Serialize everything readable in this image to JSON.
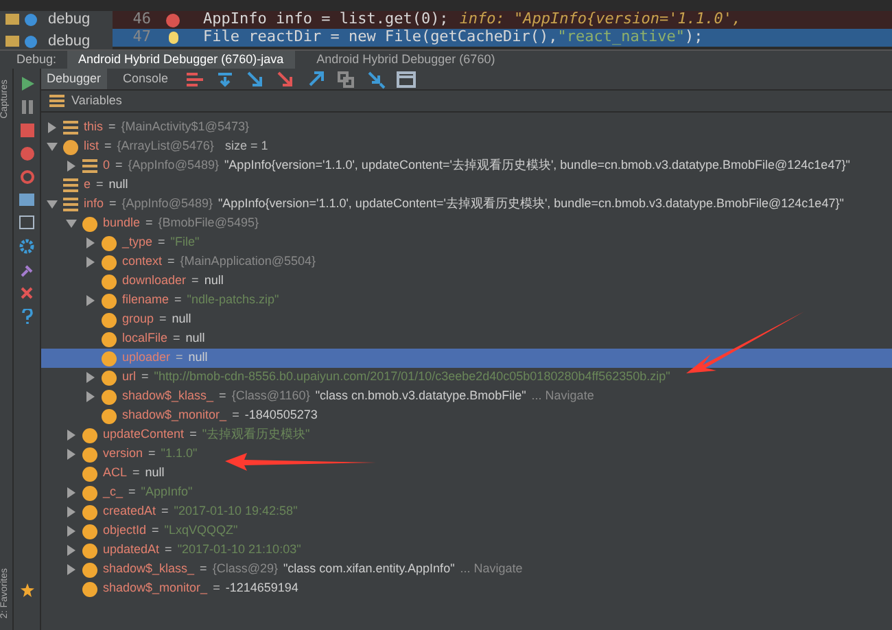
{
  "project_panel": {
    "items": [
      {
        "label": "debug"
      },
      {
        "label": "debug"
      }
    ]
  },
  "editor": {
    "lines": [
      {
        "number": "46",
        "kind": "breakpoint",
        "code": "AppInfo info = list.get(0);",
        "inline": "info: \"AppInfo{version='1.1.0',"
      },
      {
        "number": "47",
        "kind": "current",
        "code": "File reactDir = new File(getCacheDir(),",
        "string": "\"react_native\"",
        "tail": ");"
      }
    ]
  },
  "debug_bar": {
    "label": "Debug:",
    "tabs": [
      {
        "label": "Android Hybrid Debugger (6760)-java",
        "selected": true
      },
      {
        "label": "Android Hybrid Debugger (6760)",
        "selected": false
      }
    ]
  },
  "toolbar": {
    "tabs": [
      {
        "label": "Debugger",
        "selected": true
      },
      {
        "label": "Console",
        "selected": false
      }
    ]
  },
  "side_strip": {
    "labels": [
      "Captures",
      "2: Favorites"
    ]
  },
  "variables": {
    "title": "Variables",
    "tree": [
      {
        "kind": "local",
        "name": "this",
        "op": "=",
        "type": "{MainActivity$1@5473}",
        "expanded": false
      },
      {
        "kind": "parameter",
        "name": "list",
        "op": "=",
        "type": "{ArrayList@5476}",
        "extra": "size = 1",
        "expanded": true,
        "children": [
          {
            "kind": "local",
            "name": "0",
            "op": "=",
            "type": "{AppInfo@5489}",
            "value": "\"AppInfo{version='1.1.0', updateContent='去掉观看历史模块', bundle=cn.bmob.v3.datatype.BmobFile@124c1e47}\"",
            "expanded": false
          }
        ]
      },
      {
        "kind": "local",
        "name": "e",
        "op": "=",
        "value": "null"
      },
      {
        "kind": "local",
        "name": "info",
        "op": "=",
        "type": "{AppInfo@5489}",
        "value": "\"AppInfo{version='1.1.0', updateContent='去掉观看历史模块', bundle=cn.bmob.v3.datatype.BmobFile@124c1e47}\"",
        "expanded": true,
        "children": [
          {
            "kind": "field",
            "name": "bundle",
            "op": "=",
            "type": "{BmobFile@5495}",
            "expanded": true,
            "children": [
              {
                "kind": "field",
                "name": "_type",
                "op": "=",
                "string": "\"File\"",
                "expanded": false
              },
              {
                "kind": "field",
                "name": "context",
                "op": "=",
                "type": "{MainApplication@5504}",
                "expanded": false
              },
              {
                "kind": "field",
                "name": "downloader",
                "op": "=",
                "value": "null"
              },
              {
                "kind": "field",
                "name": "filename",
                "op": "=",
                "string": "\"ndle-patchs.zip\"",
                "expanded": false
              },
              {
                "kind": "field",
                "name": "group",
                "op": "=",
                "value": "null"
              },
              {
                "kind": "field",
                "name": "localFile",
                "op": "=",
                "value": "null"
              },
              {
                "kind": "field",
                "name": "uploader",
                "op": "=",
                "value": "null",
                "selected": true
              },
              {
                "kind": "field",
                "name": "url",
                "op": "=",
                "string": "\"http://bmob-cdn-8556.b0.upaiyun.com/2017/01/10/c3eebe2d40c05b0180280b4ff562350b.zip\"",
                "expanded": false
              },
              {
                "kind": "field",
                "name": "shadow$_klass_",
                "op": "=",
                "type": "{Class@1160}",
                "value": "\"class cn.bmob.v3.datatype.BmobFile\"",
                "navigate": "... Navigate",
                "expanded": false
              },
              {
                "kind": "field",
                "name": "shadow$_monitor_",
                "op": "=",
                "value": "-1840505273"
              }
            ]
          },
          {
            "kind": "field",
            "name": "updateContent",
            "op": "=",
            "string": "\"去掉观看历史模块\"",
            "expanded": false
          },
          {
            "kind": "field",
            "name": "version",
            "op": "=",
            "string": "\"1.1.0\"",
            "expanded": false
          },
          {
            "kind": "field",
            "name": "ACL",
            "op": "=",
            "value": "null"
          },
          {
            "kind": "field",
            "name": "_c_",
            "op": "=",
            "string": "\"AppInfo\"",
            "expanded": false
          },
          {
            "kind": "field",
            "name": "createdAt",
            "op": "=",
            "string": "\"2017-01-10 19:42:58\"",
            "expanded": false
          },
          {
            "kind": "field",
            "name": "objectId",
            "op": "=",
            "string": "\"LxqVQQQZ\"",
            "expanded": false
          },
          {
            "kind": "field",
            "name": "updatedAt",
            "op": "=",
            "string": "\"2017-01-10 21:10:03\"",
            "expanded": false
          },
          {
            "kind": "field",
            "name": "shadow$_klass_",
            "op": "=",
            "type": "{Class@29}",
            "value": "\"class com.xifan.entity.AppInfo\"",
            "navigate": "... Navigate",
            "expanded": false
          },
          {
            "kind": "field",
            "name": "shadow$_monitor_",
            "op": "=",
            "value": "-1214659194"
          }
        ]
      }
    ]
  }
}
